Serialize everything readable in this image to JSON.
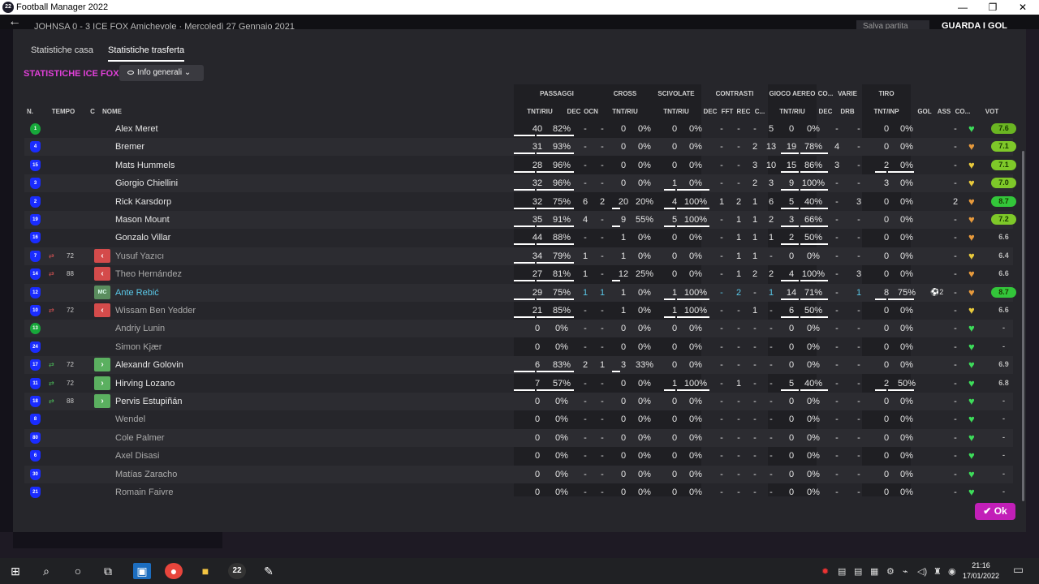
{
  "window": {
    "title": "Football Manager 2022",
    "app_icon": "22",
    "min": "—",
    "max": "❐",
    "close": "✕"
  },
  "header": {
    "back": "←",
    "crumb": "JOHNSA  0 - 3  ICE FOX  Amichevole  ·  Mercoledì 27 Gennaio 2021",
    "save": "Salva partita",
    "continue": "GUARDA I GOL"
  },
  "tabs": [
    "Statistiche casa",
    "Statistiche trasferta"
  ],
  "heading": "STATISTICHE ICE FOX",
  "dropdown": "Info generali",
  "group_headers": [
    "PASSAGGI",
    "CROSS",
    "SCIVOLATE",
    "CONTRASTI",
    "GIOCO AEREO",
    "CO...",
    "VARIE",
    "TIRO"
  ],
  "col_headers": [
    "N.",
    "TEMPO",
    "C",
    "NOME",
    "TNT/RIU",
    "DEC",
    "OCN",
    "TNT/RIU",
    "TNT/RIU",
    "DEC",
    "FFT",
    "REC",
    "C...",
    "TNT/RIU",
    "DEC",
    "DRB",
    "TNT/INP",
    "GOL",
    "ASS",
    "CO...",
    "VOT"
  ],
  "colors": {
    "accent": "#c21fb8",
    "heading": "#e040d8",
    "highlight": "#5ac8e8",
    "gk": "#17a83a",
    "outfield": "#1a2cff"
  },
  "rows": [
    {
      "num": "1",
      "pos": "gk",
      "min": "",
      "sub": "",
      "c": "",
      "name": "Alex Meret",
      "style": "",
      "pass": [
        "40",
        "82%"
      ],
      "dec": "-",
      "ocn": "-",
      "cross": [
        "0",
        "0%"
      ],
      "tack": [
        "0",
        "0%"
      ],
      "cdec": "-",
      "fft": "-",
      "rec": "-",
      "cc": "5",
      "air": [
        "0",
        "0%"
      ],
      "adec": "-",
      "drb": "-",
      "shot": [
        "0",
        "0%"
      ],
      "gol": "",
      "ass": "-",
      "morale": "green",
      "vot": "7.6",
      "votc": "#6ab522"
    },
    {
      "num": "4",
      "pos": "out",
      "min": "",
      "sub": "",
      "c": "",
      "name": "Bremer",
      "style": "",
      "pass": [
        "31",
        "93%"
      ],
      "dec": "-",
      "ocn": "-",
      "cross": [
        "0",
        "0%"
      ],
      "tack": [
        "0",
        "0%"
      ],
      "cdec": "-",
      "fft": "-",
      "rec": "2",
      "cc": "13",
      "air": [
        "19",
        "78%"
      ],
      "adec": "4",
      "drb": "-",
      "shot": [
        "0",
        "0%"
      ],
      "gol": "",
      "ass": "-",
      "morale": "orange",
      "vot": "7.1",
      "votc": "#7ec829"
    },
    {
      "num": "15",
      "pos": "out",
      "min": "",
      "sub": "",
      "c": "",
      "name": "Mats Hummels",
      "style": "",
      "pass": [
        "28",
        "96%"
      ],
      "dec": "-",
      "ocn": "-",
      "cross": [
        "0",
        "0%"
      ],
      "tack": [
        "0",
        "0%"
      ],
      "cdec": "-",
      "fft": "-",
      "rec": "3",
      "cc": "10",
      "air": [
        "15",
        "86%"
      ],
      "adec": "3",
      "drb": "-",
      "shot": [
        "2",
        "0%"
      ],
      "gol": "",
      "ass": "-",
      "morale": "yellow",
      "vot": "7.1",
      "votc": "#7ec829"
    },
    {
      "num": "3",
      "pos": "out",
      "min": "",
      "sub": "",
      "c": "",
      "name": "Giorgio Chiellini",
      "style": "",
      "pass": [
        "32",
        "96%"
      ],
      "dec": "-",
      "ocn": "-",
      "cross": [
        "0",
        "0%"
      ],
      "tack": [
        "1",
        "0%"
      ],
      "cdec": "-",
      "fft": "-",
      "rec": "2",
      "cc": "3",
      "air": [
        "9",
        "100%"
      ],
      "adec": "-",
      "drb": "-",
      "shot": [
        "3",
        "0%"
      ],
      "gol": "",
      "ass": "-",
      "morale": "yellow",
      "vot": "7.0",
      "votc": "#7ec829"
    },
    {
      "num": "2",
      "pos": "out",
      "min": "",
      "sub": "",
      "c": "",
      "name": "Rick Karsdorp",
      "style": "",
      "pass": [
        "32",
        "75%"
      ],
      "dec": "6",
      "ocn": "2",
      "cross": [
        "20",
        "20%"
      ],
      "tack": [
        "4",
        "100%"
      ],
      "cdec": "1",
      "fft": "2",
      "rec": "1",
      "cc": "6",
      "air": [
        "5",
        "40%"
      ],
      "adec": "-",
      "drb": "3",
      "shot": [
        "0",
        "0%"
      ],
      "gol": "",
      "ass": "2",
      "morale": "orange",
      "vot": "8.7",
      "votc": "#33c63a"
    },
    {
      "num": "19",
      "pos": "out",
      "min": "",
      "sub": "",
      "c": "",
      "name": "Mason Mount",
      "style": "",
      "pass": [
        "35",
        "91%"
      ],
      "dec": "4",
      "ocn": "-",
      "cross": [
        "9",
        "55%"
      ],
      "tack": [
        "5",
        "100%"
      ],
      "cdec": "-",
      "fft": "1",
      "rec": "1",
      "cc": "2",
      "air": [
        "3",
        "66%"
      ],
      "adec": "-",
      "drb": "-",
      "shot": [
        "0",
        "0%"
      ],
      "gol": "",
      "ass": "-",
      "morale": "orange",
      "vot": "7.2",
      "votc": "#7ec829"
    },
    {
      "num": "16",
      "pos": "out",
      "min": "",
      "sub": "",
      "c": "",
      "name": "Gonzalo Villar",
      "style": "",
      "pass": [
        "44",
        "88%"
      ],
      "dec": "-",
      "ocn": "-",
      "cross": [
        "1",
        "0%"
      ],
      "tack": [
        "0",
        "0%"
      ],
      "cdec": "-",
      "fft": "1",
      "rec": "1",
      "cc": "1",
      "air": [
        "2",
        "50%"
      ],
      "adec": "-",
      "drb": "-",
      "shot": [
        "0",
        "0%"
      ],
      "gol": "",
      "ass": "-",
      "morale": "orange",
      "vot": "6.6",
      "votc": ""
    },
    {
      "num": "7",
      "pos": "out",
      "min": "72",
      "sub": "out",
      "c": "red",
      "name": "Yusuf Yazıcı",
      "style": "dim",
      "pass": [
        "34",
        "79%"
      ],
      "dec": "1",
      "ocn": "-",
      "cross": [
        "1",
        "0%"
      ],
      "tack": [
        "0",
        "0%"
      ],
      "cdec": "-",
      "fft": "1",
      "rec": "1",
      "cc": "-",
      "air": [
        "0",
        "0%"
      ],
      "adec": "-",
      "drb": "-",
      "shot": [
        "0",
        "0%"
      ],
      "gol": "",
      "ass": "-",
      "morale": "yellow",
      "vot": "6.4",
      "votc": ""
    },
    {
      "num": "14",
      "pos": "out",
      "min": "88",
      "sub": "out",
      "c": "red",
      "name": "Theo Hernández",
      "style": "dim",
      "pass": [
        "27",
        "81%"
      ],
      "dec": "1",
      "ocn": "-",
      "cross": [
        "12",
        "25%"
      ],
      "tack": [
        "0",
        "0%"
      ],
      "cdec": "-",
      "fft": "1",
      "rec": "2",
      "cc": "2",
      "air": [
        "4",
        "100%"
      ],
      "adec": "-",
      "drb": "3",
      "shot": [
        "0",
        "0%"
      ],
      "gol": "",
      "ass": "-",
      "morale": "orange",
      "vot": "6.6",
      "votc": ""
    },
    {
      "num": "12",
      "pos": "out",
      "min": "",
      "sub": "",
      "c": "mc",
      "name": "Ante Rebić",
      "style": "hl",
      "pass": [
        "29",
        "75%"
      ],
      "dec": "1",
      "ocn": "1",
      "cross": [
        "1",
        "0%"
      ],
      "tack": [
        "1",
        "100%"
      ],
      "cdec": "-",
      "fft": "2",
      "rec": "-",
      "cc": "1",
      "air": [
        "14",
        "71%"
      ],
      "adec": "-",
      "drb": "1",
      "shot": [
        "8",
        "75%"
      ],
      "gol": "2",
      "ass": "-",
      "morale": "orange",
      "vot": "8.7",
      "votc": "#33c63a"
    },
    {
      "num": "10",
      "pos": "out",
      "min": "72",
      "sub": "out",
      "c": "red",
      "name": "Wissam Ben Yedder",
      "style": "dim",
      "pass": [
        "21",
        "85%"
      ],
      "dec": "-",
      "ocn": "-",
      "cross": [
        "1",
        "0%"
      ],
      "tack": [
        "1",
        "100%"
      ],
      "cdec": "-",
      "fft": "-",
      "rec": "1",
      "cc": "-",
      "air": [
        "6",
        "50%"
      ],
      "adec": "-",
      "drb": "-",
      "shot": [
        "0",
        "0%"
      ],
      "gol": "",
      "ass": "-",
      "morale": "yellow",
      "vot": "6.6",
      "votc": ""
    },
    {
      "num": "13",
      "pos": "gk",
      "min": "",
      "sub": "",
      "c": "",
      "name": "Andriy Lunin",
      "style": "dim",
      "pass": [
        "0",
        "0%"
      ],
      "dec": "-",
      "ocn": "-",
      "cross": [
        "0",
        "0%"
      ],
      "tack": [
        "0",
        "0%"
      ],
      "cdec": "-",
      "fft": "-",
      "rec": "-",
      "cc": "-",
      "air": [
        "0",
        "0%"
      ],
      "adec": "-",
      "drb": "-",
      "shot": [
        "0",
        "0%"
      ],
      "gol": "",
      "ass": "-",
      "morale": "green",
      "vot": "-",
      "votc": ""
    },
    {
      "num": "24",
      "pos": "out",
      "min": "",
      "sub": "",
      "c": "",
      "name": "Simon Kjær",
      "style": "dim",
      "pass": [
        "0",
        "0%"
      ],
      "dec": "-",
      "ocn": "-",
      "cross": [
        "0",
        "0%"
      ],
      "tack": [
        "0",
        "0%"
      ],
      "cdec": "-",
      "fft": "-",
      "rec": "-",
      "cc": "-",
      "air": [
        "0",
        "0%"
      ],
      "adec": "-",
      "drb": "-",
      "shot": [
        "0",
        "0%"
      ],
      "gol": "",
      "ass": "-",
      "morale": "green",
      "vot": "-",
      "votc": ""
    },
    {
      "num": "17",
      "pos": "out",
      "min": "72",
      "sub": "in",
      "c": "green",
      "name": "Alexandr Golovin",
      "style": "",
      "pass": [
        "6",
        "83%"
      ],
      "dec": "2",
      "ocn": "1",
      "cross": [
        "3",
        "33%"
      ],
      "tack": [
        "0",
        "0%"
      ],
      "cdec": "-",
      "fft": "-",
      "rec": "-",
      "cc": "-",
      "air": [
        "0",
        "0%"
      ],
      "adec": "-",
      "drb": "-",
      "shot": [
        "0",
        "0%"
      ],
      "gol": "",
      "ass": "-",
      "morale": "green",
      "vot": "6.9",
      "votc": ""
    },
    {
      "num": "11",
      "pos": "out",
      "min": "72",
      "sub": "in",
      "c": "green",
      "name": "Hirving Lozano",
      "style": "",
      "pass": [
        "7",
        "57%"
      ],
      "dec": "-",
      "ocn": "-",
      "cross": [
        "0",
        "0%"
      ],
      "tack": [
        "1",
        "100%"
      ],
      "cdec": "-",
      "fft": "1",
      "rec": "-",
      "cc": "-",
      "air": [
        "5",
        "40%"
      ],
      "adec": "-",
      "drb": "-",
      "shot": [
        "2",
        "50%"
      ],
      "gol": "",
      "ass": "-",
      "morale": "green",
      "vot": "6.8",
      "votc": ""
    },
    {
      "num": "18",
      "pos": "out",
      "min": "88",
      "sub": "in",
      "c": "green",
      "name": "Pervis Estupiñán",
      "style": "",
      "pass": [
        "0",
        "0%"
      ],
      "dec": "-",
      "ocn": "-",
      "cross": [
        "0",
        "0%"
      ],
      "tack": [
        "0",
        "0%"
      ],
      "cdec": "-",
      "fft": "-",
      "rec": "-",
      "cc": "-",
      "air": [
        "0",
        "0%"
      ],
      "adec": "-",
      "drb": "-",
      "shot": [
        "0",
        "0%"
      ],
      "gol": "",
      "ass": "-",
      "morale": "green",
      "vot": "-",
      "votc": ""
    },
    {
      "num": "8",
      "pos": "out",
      "min": "",
      "sub": "",
      "c": "",
      "name": "Wendel",
      "style": "dim",
      "pass": [
        "0",
        "0%"
      ],
      "dec": "-",
      "ocn": "-",
      "cross": [
        "0",
        "0%"
      ],
      "tack": [
        "0",
        "0%"
      ],
      "cdec": "-",
      "fft": "-",
      "rec": "-",
      "cc": "-",
      "air": [
        "0",
        "0%"
      ],
      "adec": "-",
      "drb": "-",
      "shot": [
        "0",
        "0%"
      ],
      "gol": "",
      "ass": "-",
      "morale": "green",
      "vot": "-",
      "votc": ""
    },
    {
      "num": "80",
      "pos": "out",
      "min": "",
      "sub": "",
      "c": "",
      "name": "Cole Palmer",
      "style": "dim",
      "pass": [
        "0",
        "0%"
      ],
      "dec": "-",
      "ocn": "-",
      "cross": [
        "0",
        "0%"
      ],
      "tack": [
        "0",
        "0%"
      ],
      "cdec": "-",
      "fft": "-",
      "rec": "-",
      "cc": "-",
      "air": [
        "0",
        "0%"
      ],
      "adec": "-",
      "drb": "-",
      "shot": [
        "0",
        "0%"
      ],
      "gol": "",
      "ass": "-",
      "morale": "green",
      "vot": "-",
      "votc": ""
    },
    {
      "num": "6",
      "pos": "out",
      "min": "",
      "sub": "",
      "c": "",
      "name": "Axel Disasi",
      "style": "dim",
      "pass": [
        "0",
        "0%"
      ],
      "dec": "-",
      "ocn": "-",
      "cross": [
        "0",
        "0%"
      ],
      "tack": [
        "0",
        "0%"
      ],
      "cdec": "-",
      "fft": "-",
      "rec": "-",
      "cc": "-",
      "air": [
        "0",
        "0%"
      ],
      "adec": "-",
      "drb": "-",
      "shot": [
        "0",
        "0%"
      ],
      "gol": "",
      "ass": "-",
      "morale": "green",
      "vot": "-",
      "votc": ""
    },
    {
      "num": "30",
      "pos": "out",
      "min": "",
      "sub": "",
      "c": "",
      "name": "Matías Zaracho",
      "style": "dim",
      "pass": [
        "0",
        "0%"
      ],
      "dec": "-",
      "ocn": "-",
      "cross": [
        "0",
        "0%"
      ],
      "tack": [
        "0",
        "0%"
      ],
      "cdec": "-",
      "fft": "-",
      "rec": "-",
      "cc": "-",
      "air": [
        "0",
        "0%"
      ],
      "adec": "-",
      "drb": "-",
      "shot": [
        "0",
        "0%"
      ],
      "gol": "",
      "ass": "-",
      "morale": "green",
      "vot": "-",
      "votc": ""
    },
    {
      "num": "21",
      "pos": "out",
      "min": "",
      "sub": "",
      "c": "",
      "name": "Romain Faivre",
      "style": "dim",
      "pass": [
        "0",
        "0%"
      ],
      "dec": "-",
      "ocn": "-",
      "cross": [
        "0",
        "0%"
      ],
      "tack": [
        "0",
        "0%"
      ],
      "cdec": "-",
      "fft": "-",
      "rec": "-",
      "cc": "-",
      "air": [
        "0",
        "0%"
      ],
      "adec": "-",
      "drb": "-",
      "shot": [
        "0",
        "0%"
      ],
      "gol": "",
      "ass": "-",
      "morale": "green",
      "vot": "-",
      "votc": ""
    }
  ],
  "ok": "Ok",
  "taskbar": {
    "time": "21:16",
    "date": "17/01/2022",
    "fm": "22"
  }
}
